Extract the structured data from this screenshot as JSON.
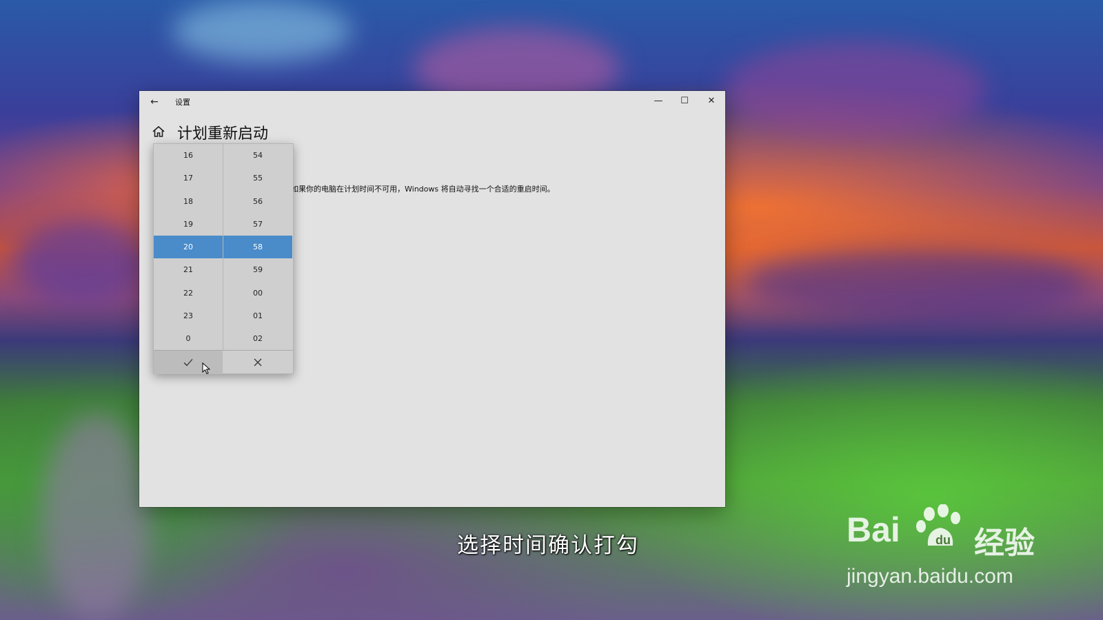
{
  "window": {
    "title": "设置",
    "page_title": "计划重新启动",
    "description": "如果你的电脑在计划时间不可用，Windows 将自动寻找一个合适的重启时间。"
  },
  "time_picker": {
    "hours": [
      "16",
      "17",
      "18",
      "19",
      "20",
      "21",
      "22",
      "23",
      "0"
    ],
    "minutes": [
      "54",
      "55",
      "56",
      "57",
      "58",
      "59",
      "00",
      "01",
      "02"
    ],
    "selected_hour": "20",
    "selected_minute": "58",
    "accent_color": "#4a8bc9"
  },
  "icons": {
    "back": "back-arrow-icon",
    "home": "home-icon",
    "minimize": "minimize-icon",
    "maximize": "maximize-icon",
    "close": "close-icon",
    "confirm": "checkmark-icon",
    "cancel": "cancel-x-icon"
  },
  "overlay": {
    "subtitle": "选择时间确认打勾",
    "watermark_brand": "Bai",
    "watermark_cn": "经验",
    "watermark_url": "jingyan.baidu.com"
  }
}
